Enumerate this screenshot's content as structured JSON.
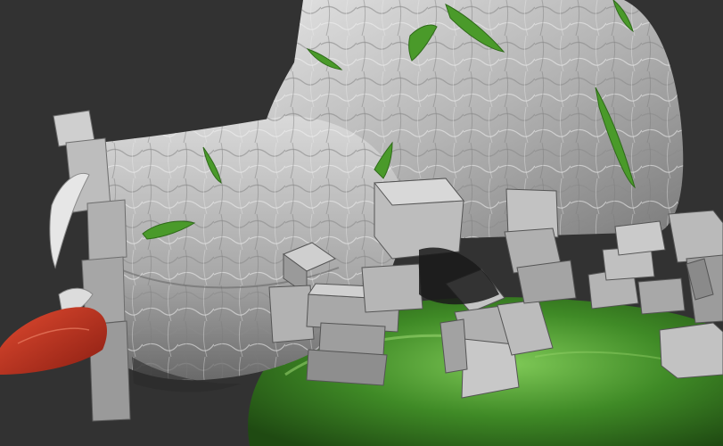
{
  "scene": {
    "subject": "",
    "colors": {
      "background": "#323232",
      "stone_light": "#cfcfcf",
      "stone_mid": "#a6a6a6",
      "stone_dark": "#6e6e6e",
      "moss": "#4a9a2a",
      "moss_dark": "#2f6a1a",
      "base_green": "#3f8a26",
      "base_green_light": "#7fc957",
      "red_bulb": "#c8321e"
    }
  }
}
